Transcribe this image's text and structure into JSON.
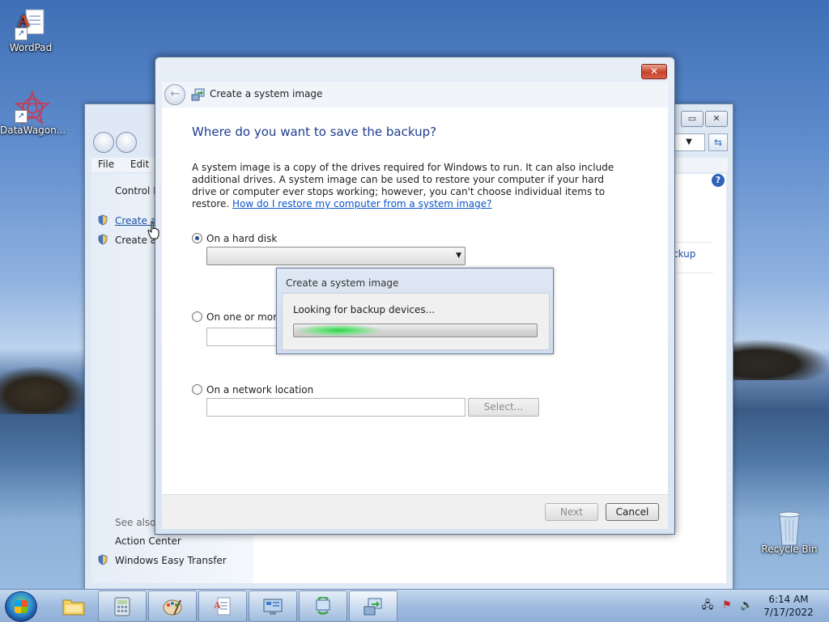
{
  "desktop": {
    "icons": [
      {
        "label": "WordPad"
      },
      {
        "label": "DataWagon..."
      },
      {
        "label": "Recycle Bin"
      }
    ]
  },
  "bg_window": {
    "menu": [
      "File",
      "Edit"
    ],
    "left_items": {
      "control_panel": "Control P",
      "create_image": "Create a s",
      "create_disc": "Create a"
    },
    "right_link": "ckup",
    "see_also": "See also",
    "action_center": "Action Center",
    "easy_transfer": "Windows Easy Transfer"
  },
  "dialog": {
    "title": "Create a system image",
    "heading": "Where do you want to save the backup?",
    "description": "A system image is a copy of the drives required for Windows to run. It can also include additional drives. A system image can be used to restore your computer if your hard drive or computer ever stops working; however, you can't choose individual items to restore. ",
    "help_link": "How do I restore my computer from a system image?",
    "options": {
      "hard_disk": "On a hard disk",
      "dvds": "On one or more",
      "network": "On a network location"
    },
    "hard_disk_selected": true,
    "select_button": "Select...",
    "next_button": "Next",
    "cancel_button": "Cancel"
  },
  "progress_popup": {
    "title": "Create a system image",
    "message": "Looking for backup devices..."
  },
  "taskbar": {
    "time": "6:14 AM",
    "date": "7/17/2022"
  },
  "colors": {
    "heading": "#1e3d8f",
    "link": "#0b54c9",
    "progress_green": "#31d14b"
  }
}
